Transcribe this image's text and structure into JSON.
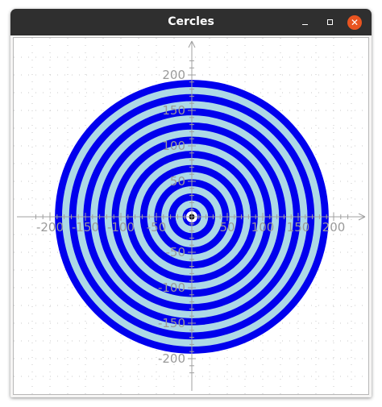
{
  "window": {
    "title": "Cercles",
    "controls": {
      "minimize": "minimize-icon",
      "maximize": "maximize-icon",
      "close": "close-icon"
    },
    "close_color": "#e95420",
    "titlebar_color": "#2f2f2f"
  },
  "plot": {
    "x_range": [
      -220,
      220
    ],
    "y_range": [
      -220,
      220
    ],
    "ticks": [
      -200,
      -150,
      -100,
      -50,
      50,
      100,
      150,
      200
    ],
    "tick_labels": [
      "-200",
      "-150",
      "-100",
      "-50",
      "50",
      "100",
      "150",
      "200"
    ],
    "grid": "dotted",
    "colors": {
      "dark_ring": "#0000ee",
      "light_ring": "#add8e6",
      "center": "#000000",
      "axis": "#a0a0a0",
      "label": "#9a9a9a"
    },
    "rings": {
      "outer_radius": 193,
      "band_width": 10,
      "center_radius": 3
    }
  }
}
